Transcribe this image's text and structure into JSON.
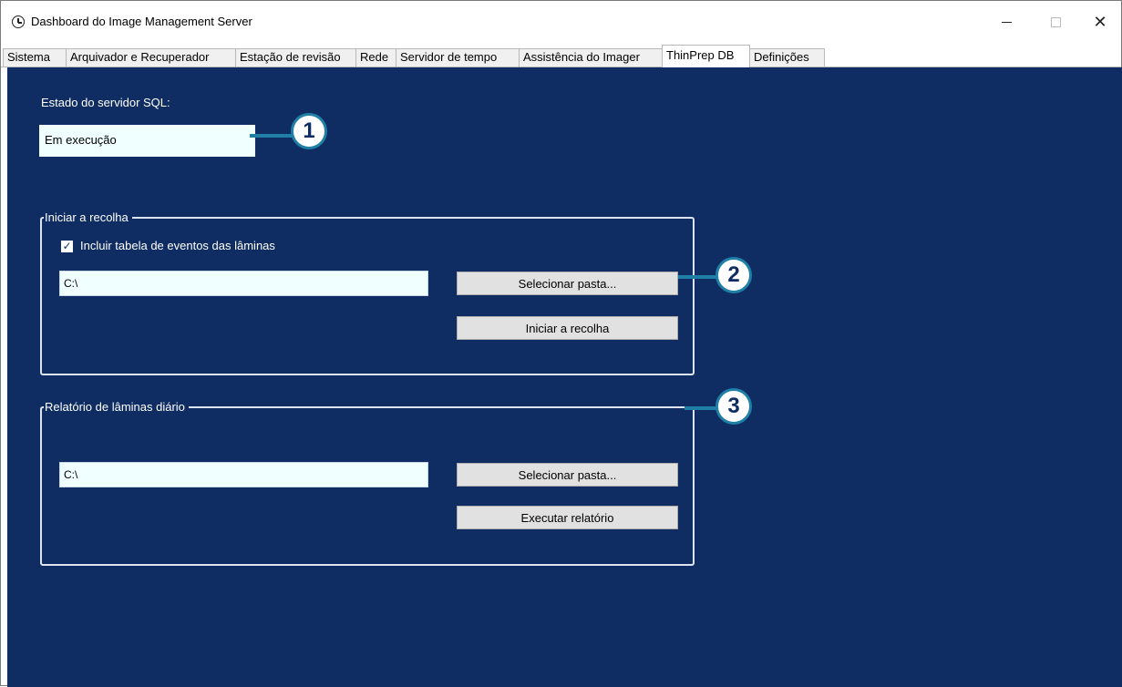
{
  "window": {
    "title": "Dashboard do Image Management Server",
    "controls": {
      "minimize_icon": "minimize-icon",
      "maximize_icon": "maximize-icon",
      "close_icon": "close-icon",
      "close_glyph": "✕"
    }
  },
  "tabs": [
    {
      "label": "Sistema"
    },
    {
      "label": "Arquivador e Recuperador"
    },
    {
      "label": "Estação de revisão"
    },
    {
      "label": "Rede"
    },
    {
      "label": "Servidor de tempo"
    },
    {
      "label": "Assistência do Imager"
    },
    {
      "label": "ThinPrep DB",
      "active": true
    },
    {
      "label": "Definições"
    }
  ],
  "sql_status": {
    "label": "Estado do servidor SQL:",
    "value": "Em execução"
  },
  "collection": {
    "title": "Iniciar a recolha",
    "checkbox_label": "Incluir tabela de eventos das lâminas",
    "checkbox_checked": true,
    "path_value": "C:\\",
    "select_folder_button": "Selecionar pasta...",
    "start_button": "Iniciar a recolha"
  },
  "daily_report": {
    "title": "Relatório de lâminas diário",
    "path_value": "C:\\",
    "select_folder_button": "Selecionar pasta...",
    "run_button": "Executar relatório"
  },
  "callouts": [
    "1",
    "2",
    "3"
  ],
  "colors": {
    "panel_background": "#0f2d62",
    "callout_accent": "#1f7fa6",
    "input_background": "#f0ffff"
  }
}
